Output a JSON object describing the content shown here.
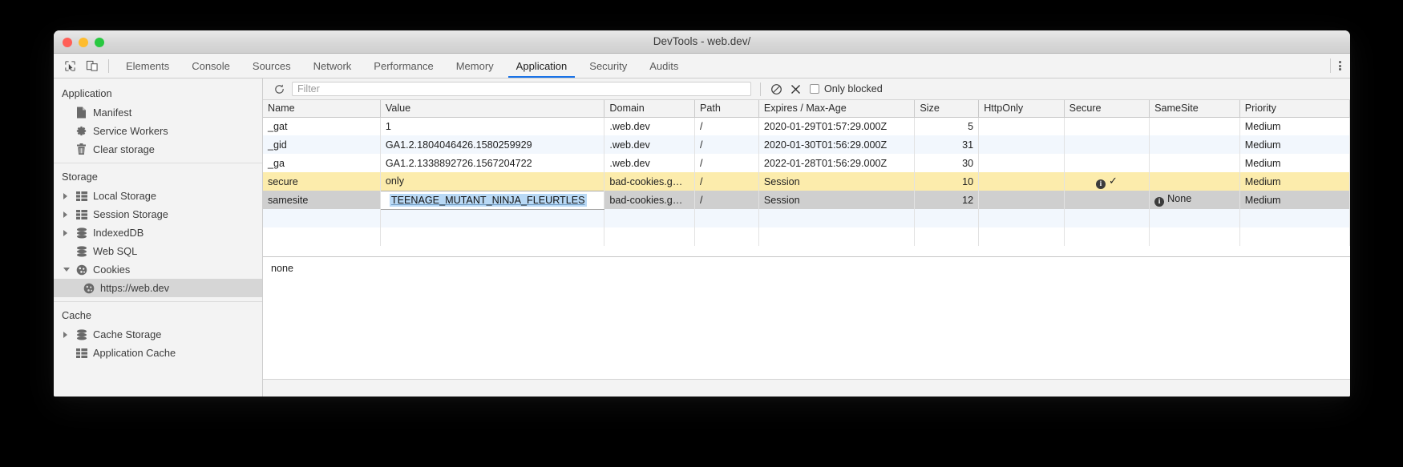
{
  "window": {
    "title": "DevTools - web.dev/",
    "traffic_lights": [
      "close",
      "minimize",
      "zoom"
    ]
  },
  "tabbar": {
    "tools": [
      {
        "name": "inspect-element-icon",
        "label": "Inspect"
      },
      {
        "name": "device-toolbar-icon",
        "label": "Toggle device toolbar"
      }
    ],
    "tabs": [
      {
        "label": "Elements",
        "active": false
      },
      {
        "label": "Console",
        "active": false
      },
      {
        "label": "Sources",
        "active": false
      },
      {
        "label": "Network",
        "active": false
      },
      {
        "label": "Performance",
        "active": false
      },
      {
        "label": "Memory",
        "active": false
      },
      {
        "label": "Application",
        "active": true
      },
      {
        "label": "Security",
        "active": false
      },
      {
        "label": "Audits",
        "active": false
      }
    ],
    "menu_label": "Customize and control DevTools",
    "active_tab_accent": "#1a73e8"
  },
  "sidebar": {
    "sections": [
      {
        "title": "Application",
        "items": [
          {
            "label": "Manifest",
            "icon": "document-icon",
            "twisty": "none",
            "selected": false,
            "indent": false
          },
          {
            "label": "Service Workers",
            "icon": "gear-icon",
            "twisty": "none",
            "selected": false,
            "indent": false
          },
          {
            "label": "Clear storage",
            "icon": "trash-icon",
            "twisty": "none",
            "selected": false,
            "indent": false
          }
        ]
      },
      {
        "title": "Storage",
        "items": [
          {
            "label": "Local Storage",
            "icon": "table-icon",
            "twisty": "right",
            "selected": false,
            "indent": false
          },
          {
            "label": "Session Storage",
            "icon": "table-icon",
            "twisty": "right",
            "selected": false,
            "indent": false
          },
          {
            "label": "IndexedDB",
            "icon": "database-icon",
            "twisty": "right",
            "selected": false,
            "indent": false
          },
          {
            "label": "Web SQL",
            "icon": "database-icon",
            "twisty": "none",
            "selected": false,
            "indent": false
          },
          {
            "label": "Cookies",
            "icon": "cookie-icon",
            "twisty": "down",
            "selected": false,
            "indent": false
          },
          {
            "label": "https://web.dev",
            "icon": "cookie-icon",
            "twisty": "none",
            "selected": true,
            "indent": true
          }
        ]
      },
      {
        "title": "Cache",
        "items": [
          {
            "label": "Cache Storage",
            "icon": "database-icon",
            "twisty": "right",
            "selected": false,
            "indent": false
          },
          {
            "label": "Application Cache",
            "icon": "table-icon",
            "twisty": "none",
            "selected": false,
            "indent": false
          }
        ]
      }
    ]
  },
  "toolbar": {
    "refresh_label": "Refresh",
    "filter_placeholder": "Filter",
    "filter_value": "",
    "clear_filter_label": "Clear filter",
    "delete_all_label": "Clear all cookies",
    "only_blocked_label": "Only blocked",
    "only_blocked_checked": false
  },
  "table": {
    "columns": [
      "Name",
      "Value",
      "Domain",
      "Path",
      "Expires / Max-Age",
      "Size",
      "HttpOnly",
      "Secure",
      "SameSite",
      "Priority"
    ],
    "rows": [
      {
        "style": "even",
        "name": "_gat",
        "value": "1",
        "domain": ".web.dev",
        "path": "/",
        "expires": "2020-01-29T01:57:29.000Z",
        "size": "5",
        "httponly": "",
        "secure": "",
        "secure_info": false,
        "samesite": "",
        "samesite_info": false,
        "priority": "Medium"
      },
      {
        "style": "odd",
        "name": "_gid",
        "value": "GA1.2.1804046426.1580259929",
        "domain": ".web.dev",
        "path": "/",
        "expires": "2020-01-30T01:56:29.000Z",
        "size": "31",
        "httponly": "",
        "secure": "",
        "secure_info": false,
        "samesite": "",
        "samesite_info": false,
        "priority": "Medium"
      },
      {
        "style": "even",
        "name": "_ga",
        "value": "GA1.2.1338892726.1567204722",
        "domain": ".web.dev",
        "path": "/",
        "expires": "2022-01-28T01:56:29.000Z",
        "size": "30",
        "httponly": "",
        "secure": "",
        "secure_info": false,
        "samesite": "",
        "samesite_info": false,
        "priority": "Medium"
      },
      {
        "style": "yellow",
        "name": "secure",
        "value": "only",
        "domain": "bad-cookies.g…",
        "path": "/",
        "expires": "Session",
        "size": "10",
        "httponly": "",
        "secure": "✓",
        "secure_info": true,
        "samesite": "",
        "samesite_info": false,
        "priority": "Medium"
      },
      {
        "style": "gray",
        "name": "samesite",
        "value": "TEENAGE_MUTANT_NINJA_FLEURTLES",
        "editing": true,
        "domain": "bad-cookies.g…",
        "path": "/",
        "expires": "Session",
        "size": "12",
        "httponly": "",
        "secure": "",
        "secure_info": false,
        "samesite": "None",
        "samesite_info": true,
        "priority": "Medium"
      }
    ],
    "empty_row_styles": [
      "odd",
      "even"
    ]
  },
  "preview": {
    "text": "none"
  },
  "colors": {
    "accent": "#1a73e8",
    "row_highlight_yellow": "#fcecac",
    "row_selected_gray": "#cfcfcf",
    "row_stripe": "#f2f7fd",
    "selection_blue": "#b9d9f5"
  }
}
